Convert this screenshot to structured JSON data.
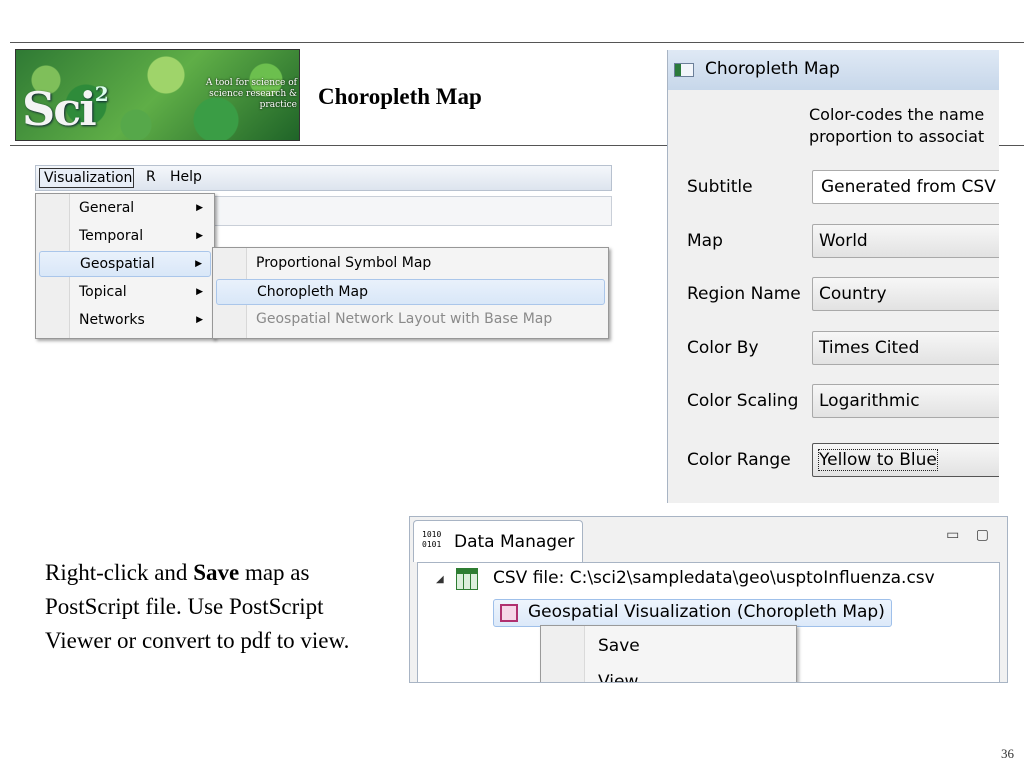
{
  "slide": {
    "title": "Choropleth Map",
    "page_number": "36",
    "body_before_bold": "Right-click and ",
    "body_bold": "Save",
    "body_after_bold": " map as PostScript file. Use PostScript Viewer or convert to pdf  to view."
  },
  "logo": {
    "mark": "Sci",
    "mark_superscript": "2",
    "tagline": "A tool for science of science research & practice"
  },
  "menubar": {
    "items": [
      "Visualization",
      "R",
      "Help"
    ],
    "open_item": "Visualization"
  },
  "visualization_menu": {
    "items": [
      {
        "label": "General",
        "has_submenu": true
      },
      {
        "label": "Temporal",
        "has_submenu": true
      },
      {
        "label": "Geospatial",
        "has_submenu": true,
        "active": true
      },
      {
        "label": "Topical",
        "has_submenu": true
      },
      {
        "label": "Networks",
        "has_submenu": true
      }
    ]
  },
  "geospatial_submenu": {
    "items": [
      {
        "label": "Proportional Symbol Map",
        "enabled": true
      },
      {
        "label": "Choropleth Map",
        "enabled": true,
        "highlighted": true
      },
      {
        "label": "Geospatial Network Layout with Base Map",
        "enabled": false
      }
    ]
  },
  "dialog": {
    "title": "Choropleth Map",
    "description_line1": "Color-codes the name",
    "description_line2": "proportion to associat",
    "fields": {
      "subtitle": {
        "label": "Subtitle",
        "value": "Generated from CSV"
      },
      "map": {
        "label": "Map",
        "value": "World"
      },
      "region_name": {
        "label": "Region Name",
        "value": "Country"
      },
      "color_by": {
        "label": "Color By",
        "value": "Times Cited"
      },
      "color_scaling": {
        "label": "Color Scaling",
        "value": "Logarithmic"
      },
      "color_range": {
        "label": "Color Range",
        "value": "Yellow to Blue"
      }
    }
  },
  "data_manager": {
    "tab_icon_text_line1": "1010",
    "tab_icon_text_line2": "0101",
    "tab_label": "Data Manager",
    "window_controls": "▭ ▢",
    "csv_item": "CSV file: C:\\sci2\\sampledata\\geo\\usptoInfluenza.csv",
    "geo_item": "Geospatial Visualization (Choropleth Map)",
    "context_menu": [
      "Save",
      "View"
    ]
  },
  "icons": {
    "submenu_arrow": "▶",
    "tree_expanded": "◢"
  }
}
